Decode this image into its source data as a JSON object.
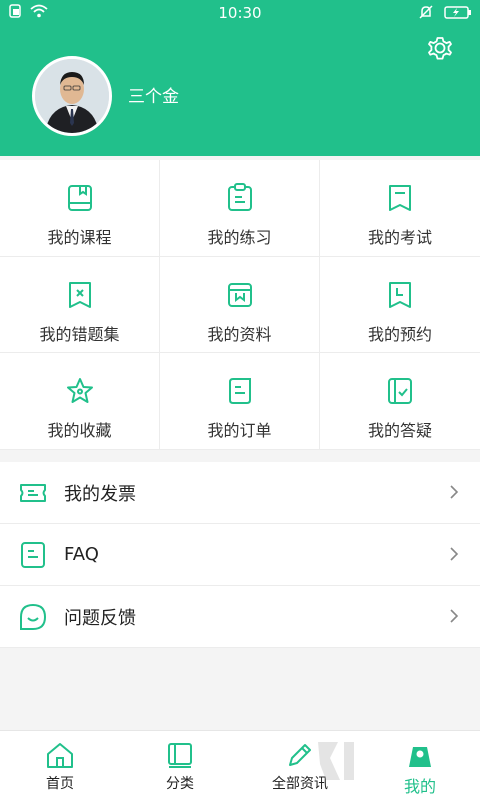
{
  "status": {
    "time": "10:30"
  },
  "profile": {
    "name": "三个金"
  },
  "grid": [
    {
      "label": "我的课程",
      "icon": "book-icon"
    },
    {
      "label": "我的练习",
      "icon": "clipboard-icon"
    },
    {
      "label": "我的考试",
      "icon": "bookmark-icon"
    },
    {
      "label": "我的错题集",
      "icon": "wrong-question-icon"
    },
    {
      "label": "我的资料",
      "icon": "materials-icon"
    },
    {
      "label": "我的预约",
      "icon": "clock-bookmark-icon"
    },
    {
      "label": "我的收藏",
      "icon": "star-icon"
    },
    {
      "label": "我的订单",
      "icon": "order-icon"
    },
    {
      "label": "我的答疑",
      "icon": "qa-icon"
    }
  ],
  "list": [
    {
      "label": "我的发票",
      "icon": "ticket-icon"
    },
    {
      "label": "FAQ",
      "icon": "document-icon"
    },
    {
      "label": "问题反馈",
      "icon": "feedback-icon"
    }
  ],
  "tabs": [
    {
      "label": "首页",
      "icon": "home-icon"
    },
    {
      "label": "分类",
      "icon": "category-book-icon"
    },
    {
      "label": "全部资讯",
      "icon": "pencil-icon"
    },
    {
      "label": "我的",
      "icon": "profile-icon"
    }
  ],
  "colors": {
    "accent": "#21c08b"
  }
}
